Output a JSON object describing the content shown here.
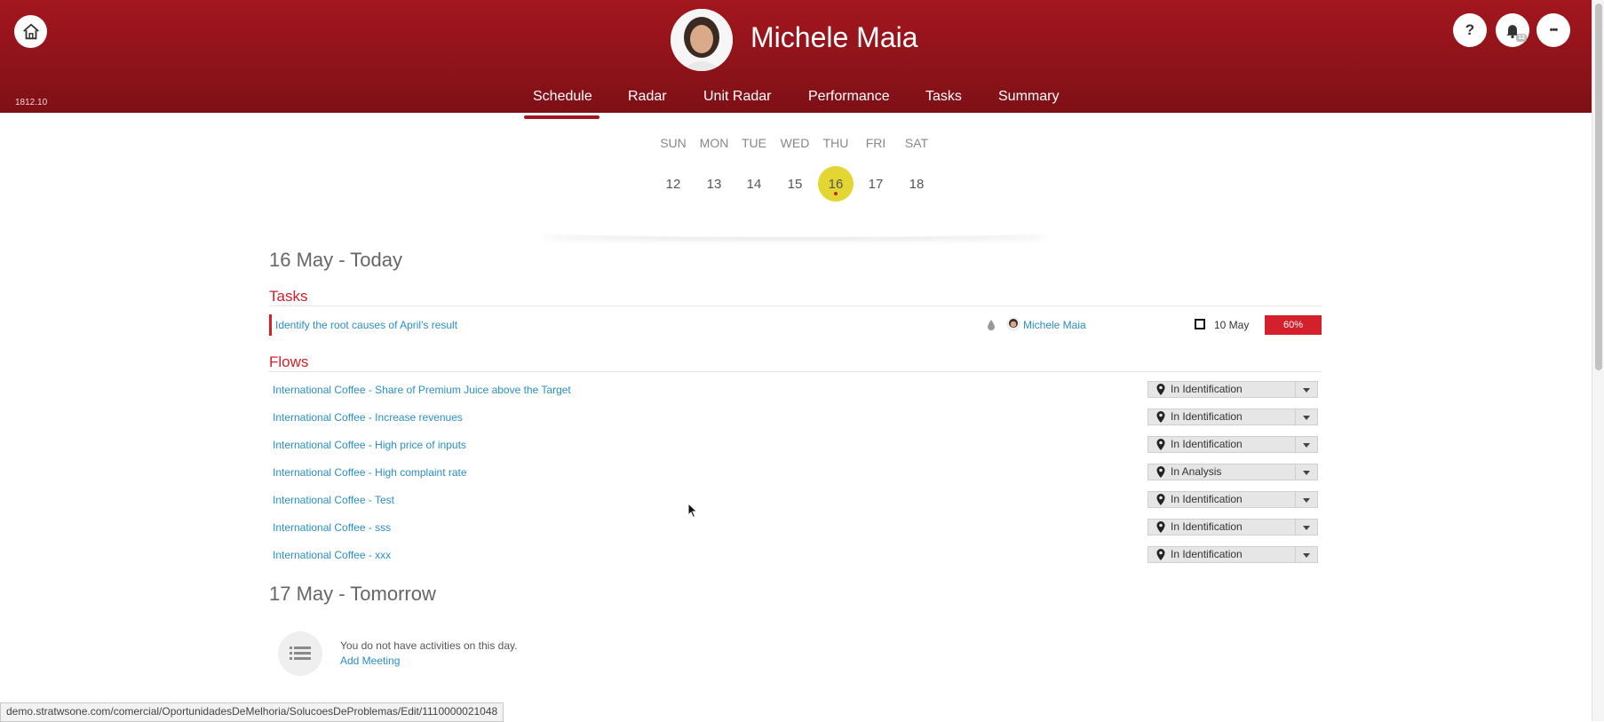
{
  "header": {
    "version": "1812.10",
    "user_name": "Michele Maia",
    "notification_count": "12",
    "help_label": "?",
    "more_label": "•••"
  },
  "nav": {
    "tabs": [
      {
        "label": "Schedule",
        "active": true
      },
      {
        "label": "Radar"
      },
      {
        "label": "Unit Radar"
      },
      {
        "label": "Performance"
      },
      {
        "label": "Tasks"
      },
      {
        "label": "Summary"
      }
    ]
  },
  "week": {
    "days": [
      "SUN",
      "MON",
      "TUE",
      "WED",
      "THU",
      "FRI",
      "SAT"
    ],
    "dates": [
      "12",
      "13",
      "14",
      "15",
      "16",
      "17",
      "18"
    ],
    "today": "16",
    "today_color": "#e3d532"
  },
  "today": {
    "title": "16 May - Today",
    "tasks_title": "Tasks",
    "task": {
      "name": "Identify the root causes of April's result",
      "owner": "Michele Maia",
      "due": "10 May",
      "progress": "60%"
    },
    "flows_title": "Flows",
    "flows": [
      {
        "name": "International Coffee - Share of Premium Juice above the Target",
        "status": "In Identification"
      },
      {
        "name": "International Coffee - Increase revenues",
        "status": "In Identification"
      },
      {
        "name": "International Coffee - High price of inputs",
        "status": "In Identification"
      },
      {
        "name": "International Coffee - High complaint rate",
        "status": "In Analysis"
      },
      {
        "name": "International Coffee - Test",
        "status": "In Identification"
      },
      {
        "name": "International Coffee - sss",
        "status": "In Identification"
      },
      {
        "name": "International Coffee - xxx",
        "status": "In Identification"
      }
    ]
  },
  "tomorrow": {
    "title": "17 May - Tomorrow",
    "empty_text": "You do not have activities on this day.",
    "add_meeting": "Add Meeting"
  },
  "status_bar": {
    "url": "demo.stratwsone.com/comercial/OportunidadesDeMelhoria/SolucoesDeProblemas/Edit/1110000021048"
  },
  "colors": {
    "brand_red": "#a3161e",
    "accent_red": "#d02028",
    "link_blue": "#2a8fc5"
  }
}
